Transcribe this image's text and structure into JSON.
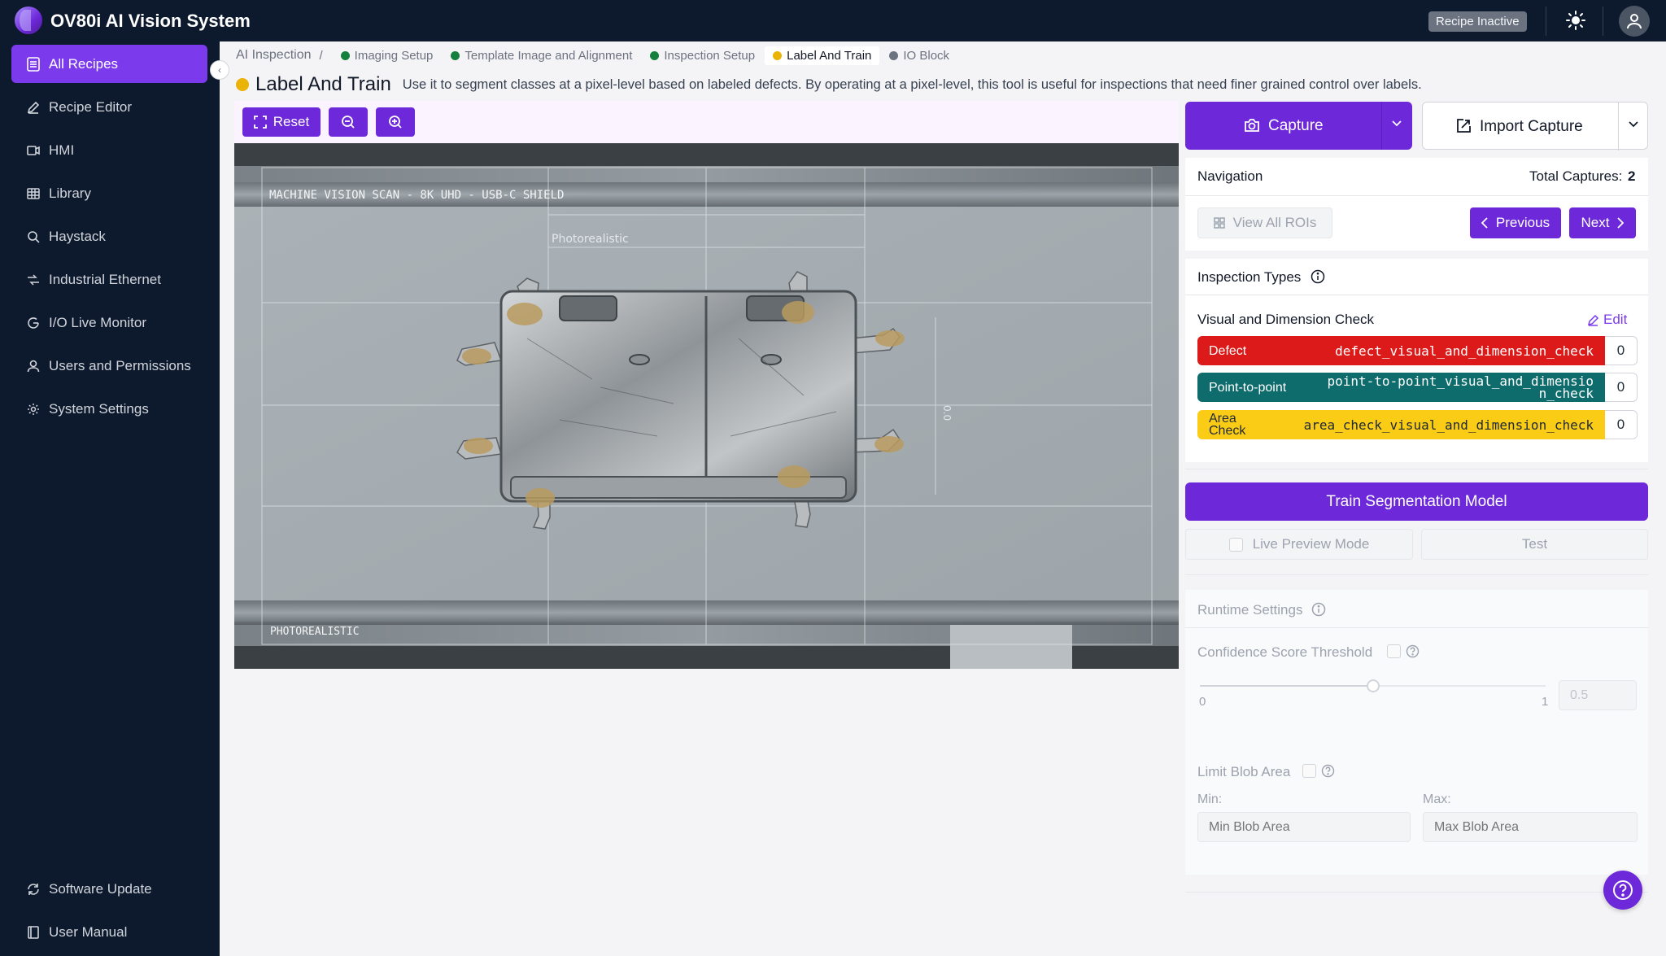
{
  "app": {
    "title": "OV80i AI Vision System",
    "recipe_status": "Recipe Inactive"
  },
  "sidebar": {
    "items": [
      {
        "label": "All Recipes",
        "icon": "document-icon",
        "active": true
      },
      {
        "label": "Recipe Editor",
        "icon": "pencil-icon"
      },
      {
        "label": "HMI",
        "icon": "display-icon"
      },
      {
        "label": "Library",
        "icon": "grid-icon"
      },
      {
        "label": "Haystack",
        "icon": "search-icon"
      },
      {
        "label": "Industrial Ethernet",
        "icon": "network-icon"
      },
      {
        "label": "I/O Live Monitor",
        "icon": "monitor-icon"
      },
      {
        "label": "Users and Permissions",
        "icon": "user-icon"
      },
      {
        "label": "System Settings",
        "icon": "gear-icon"
      }
    ],
    "bottom": [
      {
        "label": "Software Update",
        "icon": "refresh-icon"
      },
      {
        "label": "User Manual",
        "icon": "book-icon"
      }
    ]
  },
  "breadcrumb": {
    "root": "AI Inspection",
    "separator": "/",
    "steps": [
      {
        "label": "Imaging Setup",
        "color": "#15803d"
      },
      {
        "label": "Template Image and Alignment",
        "color": "#15803d"
      },
      {
        "label": "Inspection Setup",
        "color": "#15803d"
      },
      {
        "label": "Label And Train",
        "color": "#eab308"
      },
      {
        "label": "IO Block",
        "color": "#6b7280"
      }
    ]
  },
  "page": {
    "title": "Label And Train",
    "description": "Use it to segment classes at a pixel-level based on labeled defects. By operating at a pixel-level, this tool is useful for inspections that need finer grained control over labels."
  },
  "toolbar": {
    "reset_label": "Reset"
  },
  "viewer": {
    "banner_top": "MACHINE VISION SCAN - 8K UHD - USB-C SHIELD",
    "banner_mid": "Photorealistic",
    "banner_bottom": "PHOTOREALISTIC",
    "side_readout": "0.0"
  },
  "capture": {
    "capture_label": "Capture",
    "import_label": "Import Capture"
  },
  "navigation": {
    "title": "Navigation",
    "total_label": "Total Captures:",
    "total_value": "2",
    "view_all_label": "View All ROIs",
    "previous_label": "Previous",
    "next_label": "Next"
  },
  "inspection_types": {
    "title": "Inspection Types",
    "group_title": "Visual and Dimension Check",
    "edit_label": "Edit",
    "types": [
      {
        "name": "Defect",
        "id": "defect_visual_and_dimension_check",
        "count": "0",
        "bg": "#dc1a1a",
        "fg": "#ffffff"
      },
      {
        "name": "Point-to-point",
        "id": "point-to-point_visual_and_dimension_check",
        "count": "0",
        "bg": "#0e6c6c",
        "fg": "#ffffff"
      },
      {
        "name": "Area Check",
        "id": "area_check_visual_and_dimension_check",
        "count": "0",
        "bg": "#facc15",
        "fg": "#1f2937"
      }
    ]
  },
  "train": {
    "train_label": "Train Segmentation Model",
    "live_preview_label": "Live Preview Mode",
    "test_label": "Test"
  },
  "runtime": {
    "title": "Runtime Settings",
    "confidence_label": "Confidence Score Threshold",
    "slider_min": "0",
    "slider_max": "1",
    "slider_value": 0.5,
    "threshold_value": "0.5",
    "limit_blob_label": "Limit Blob Area",
    "min_label": "Min:",
    "max_label": "Max:",
    "min_placeholder": "Min Blob Area",
    "max_placeholder": "Max Blob Area"
  }
}
